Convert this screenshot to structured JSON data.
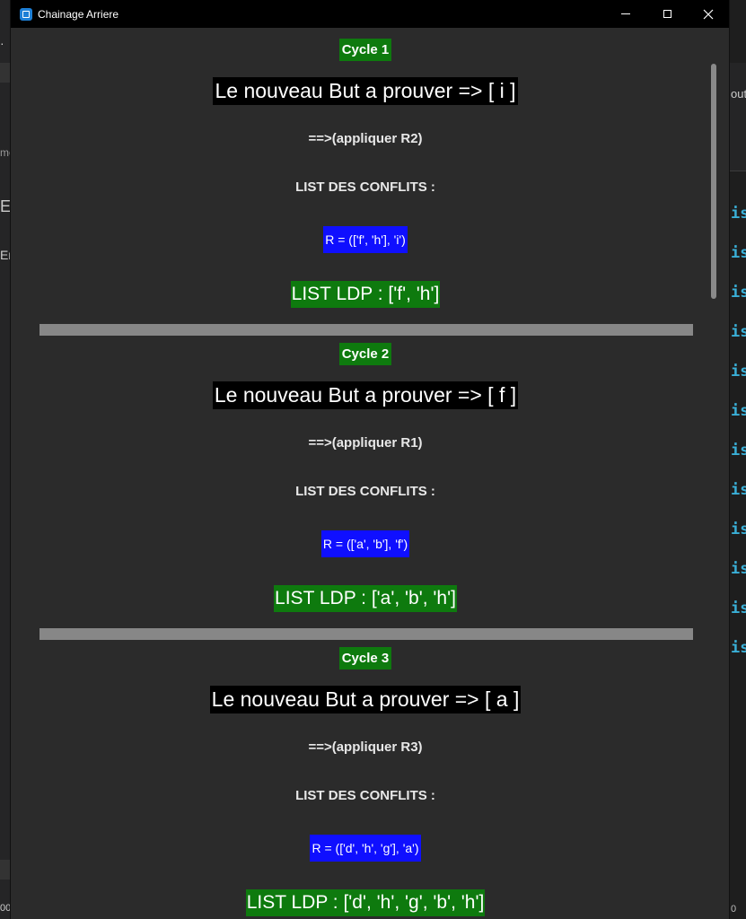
{
  "window": {
    "title": "Chainage Arriere",
    "controls": {
      "minimize": "minimize",
      "maximize": "maximize",
      "close": "close"
    }
  },
  "background": {
    "left_fragments": [
      "·",
      "mo",
      "Er",
      "En",
      "00"
    ],
    "right_fragments": [
      "out",
      "is",
      "is",
      "is",
      "is",
      "is",
      "is",
      "is",
      "is",
      "is",
      "is",
      "is",
      "is",
      "0"
    ]
  },
  "cycles": [
    {
      "label": "Cycle 1",
      "goal": "Le nouveau But a prouver => [ i ]",
      "apply": "==>(appliquer R2)",
      "conflicts_title": "LIST DES CONFLITS :",
      "rule": "R = (['f', 'h'], 'i')",
      "ldp": "LIST LDP : ['f', 'h']"
    },
    {
      "label": "Cycle 2",
      "goal": "Le nouveau But a prouver => [ f ]",
      "apply": "==>(appliquer R1)",
      "conflicts_title": "LIST DES CONFLITS :",
      "rule": "R = (['a', 'b'], 'f')",
      "ldp": "LIST LDP : ['a', 'b', 'h']"
    },
    {
      "label": "Cycle 3",
      "goal": "Le nouveau But a prouver => [ a ]",
      "apply": "==>(appliquer R3)",
      "conflicts_title": "LIST DES CONFLITS :",
      "rule": "R = (['d', 'h', 'g'], 'a')",
      "ldp": "LIST LDP : ['d', 'h', 'g', 'b', 'h']"
    }
  ],
  "colors": {
    "cycle_bg": "#0e7a0e",
    "goal_bg": "#000000",
    "rule_bg": "#0f0fff",
    "ldp_bg": "#0e7a0e",
    "separator": "#878787",
    "window_bg": "#2b2b2b"
  }
}
